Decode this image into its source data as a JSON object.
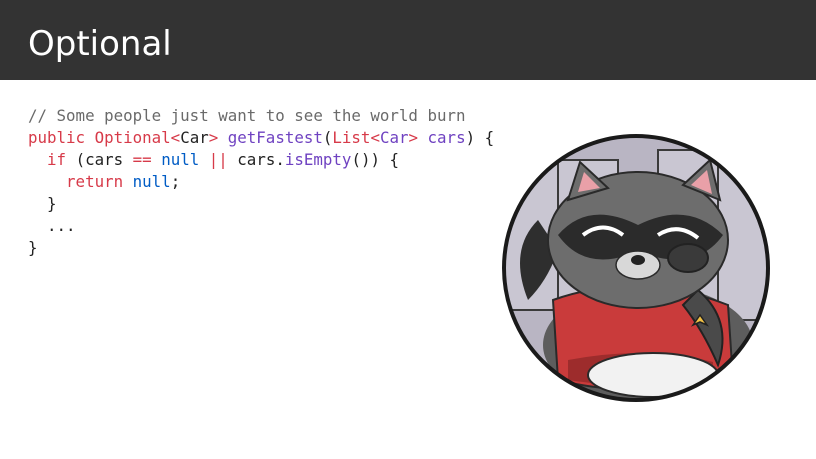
{
  "slide": {
    "title": "Optional"
  },
  "code": {
    "lines": [
      [
        {
          "t": "// Some people just want to see the world burn",
          "c": "comment"
        }
      ],
      [
        {
          "t": "public ",
          "c": "kw"
        },
        {
          "t": "Optional",
          "c": "kw"
        },
        {
          "t": "<",
          "c": "kw"
        },
        {
          "t": "Car",
          "c": "plain"
        },
        {
          "t": "> ",
          "c": "kw"
        },
        {
          "t": "getFastest",
          "c": "fn"
        },
        {
          "t": "(",
          "c": "plain"
        },
        {
          "t": "List",
          "c": "kw"
        },
        {
          "t": "<",
          "c": "kw"
        },
        {
          "t": "Car",
          "c": "type"
        },
        {
          "t": "> ",
          "c": "kw"
        },
        {
          "t": "cars",
          "c": "type"
        },
        {
          "t": ") {",
          "c": "plain"
        }
      ],
      [
        {
          "t": "  ",
          "c": "plain"
        },
        {
          "t": "if",
          "c": "kw"
        },
        {
          "t": " (cars ",
          "c": "plain"
        },
        {
          "t": "==",
          "c": "op"
        },
        {
          "t": " ",
          "c": "plain"
        },
        {
          "t": "null",
          "c": "lit"
        },
        {
          "t": " ",
          "c": "plain"
        },
        {
          "t": "||",
          "c": "op"
        },
        {
          "t": " cars.",
          "c": "plain"
        },
        {
          "t": "isEmpty",
          "c": "fn"
        },
        {
          "t": "()) {",
          "c": "plain"
        }
      ],
      [
        {
          "t": "    ",
          "c": "plain"
        },
        {
          "t": "return",
          "c": "kw"
        },
        {
          "t": " ",
          "c": "plain"
        },
        {
          "t": "null",
          "c": "lit"
        },
        {
          "t": ";",
          "c": "plain"
        }
      ],
      [
        {
          "t": "  }",
          "c": "plain"
        }
      ],
      [
        {
          "t": "  ...",
          "c": "plain"
        }
      ],
      [
        {
          "t": "}",
          "c": "plain"
        }
      ]
    ]
  },
  "illustration": {
    "icon": "raccoon-facepalm-icon",
    "colors": {
      "frame": "#1a1a1a",
      "background": "#b9b5c3",
      "fur_dark": "#4a4a4a",
      "fur_mid": "#6d6d6d",
      "mask": "#2b2b2b",
      "shirt": "#c93b3b",
      "belly": "#f2f2f2"
    }
  }
}
